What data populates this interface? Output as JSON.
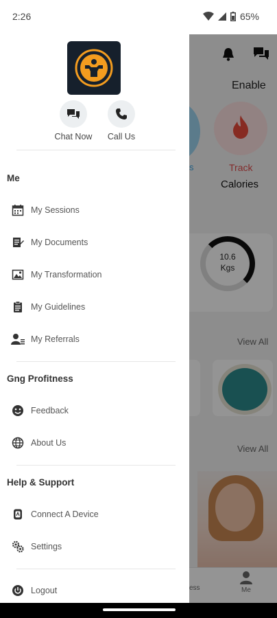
{
  "status_bar": {
    "time": "2:26",
    "battery": "65%"
  },
  "background_app": {
    "enable_label": "Enable",
    "track_label": "Track",
    "calories_label": "Calories",
    "ring_value": "10.6",
    "ring_unit": "Kgs",
    "view_all_1": "View All",
    "view_all_2": "View All",
    "nav_me": "Me",
    "nav_partial": "ess"
  },
  "drawer": {
    "logo_icon": "gym-logo-icon",
    "quick_actions": [
      {
        "label": "Chat Now",
        "icon": "chat-icon"
      },
      {
        "label": "Call Us",
        "icon": "phone-icon"
      }
    ],
    "sections": [
      {
        "title": "Me",
        "items": [
          {
            "label": "My Sessions",
            "icon": "calendar-icon"
          },
          {
            "label": "My Documents",
            "icon": "document-icon"
          },
          {
            "label": "My Transformation",
            "icon": "image-icon"
          },
          {
            "label": "My Guidelines",
            "icon": "clipboard-icon"
          },
          {
            "label": "My Referrals",
            "icon": "referral-icon"
          }
        ]
      },
      {
        "title": "Gng Profitness",
        "items": [
          {
            "label": "Feedback",
            "icon": "smiley-icon"
          },
          {
            "label": "About Us",
            "icon": "globe-icon"
          }
        ]
      },
      {
        "title": "Help & Support",
        "items": [
          {
            "label": "Connect A Device",
            "icon": "device-icon"
          },
          {
            "label": "Settings",
            "icon": "gears-icon"
          },
          {
            "label": "Logout",
            "icon": "power-icon"
          }
        ]
      }
    ]
  },
  "colors": {
    "logo_bg": "#16202c",
    "logo_accent": "#f39c1f",
    "track_red": "#e04b4b"
  }
}
